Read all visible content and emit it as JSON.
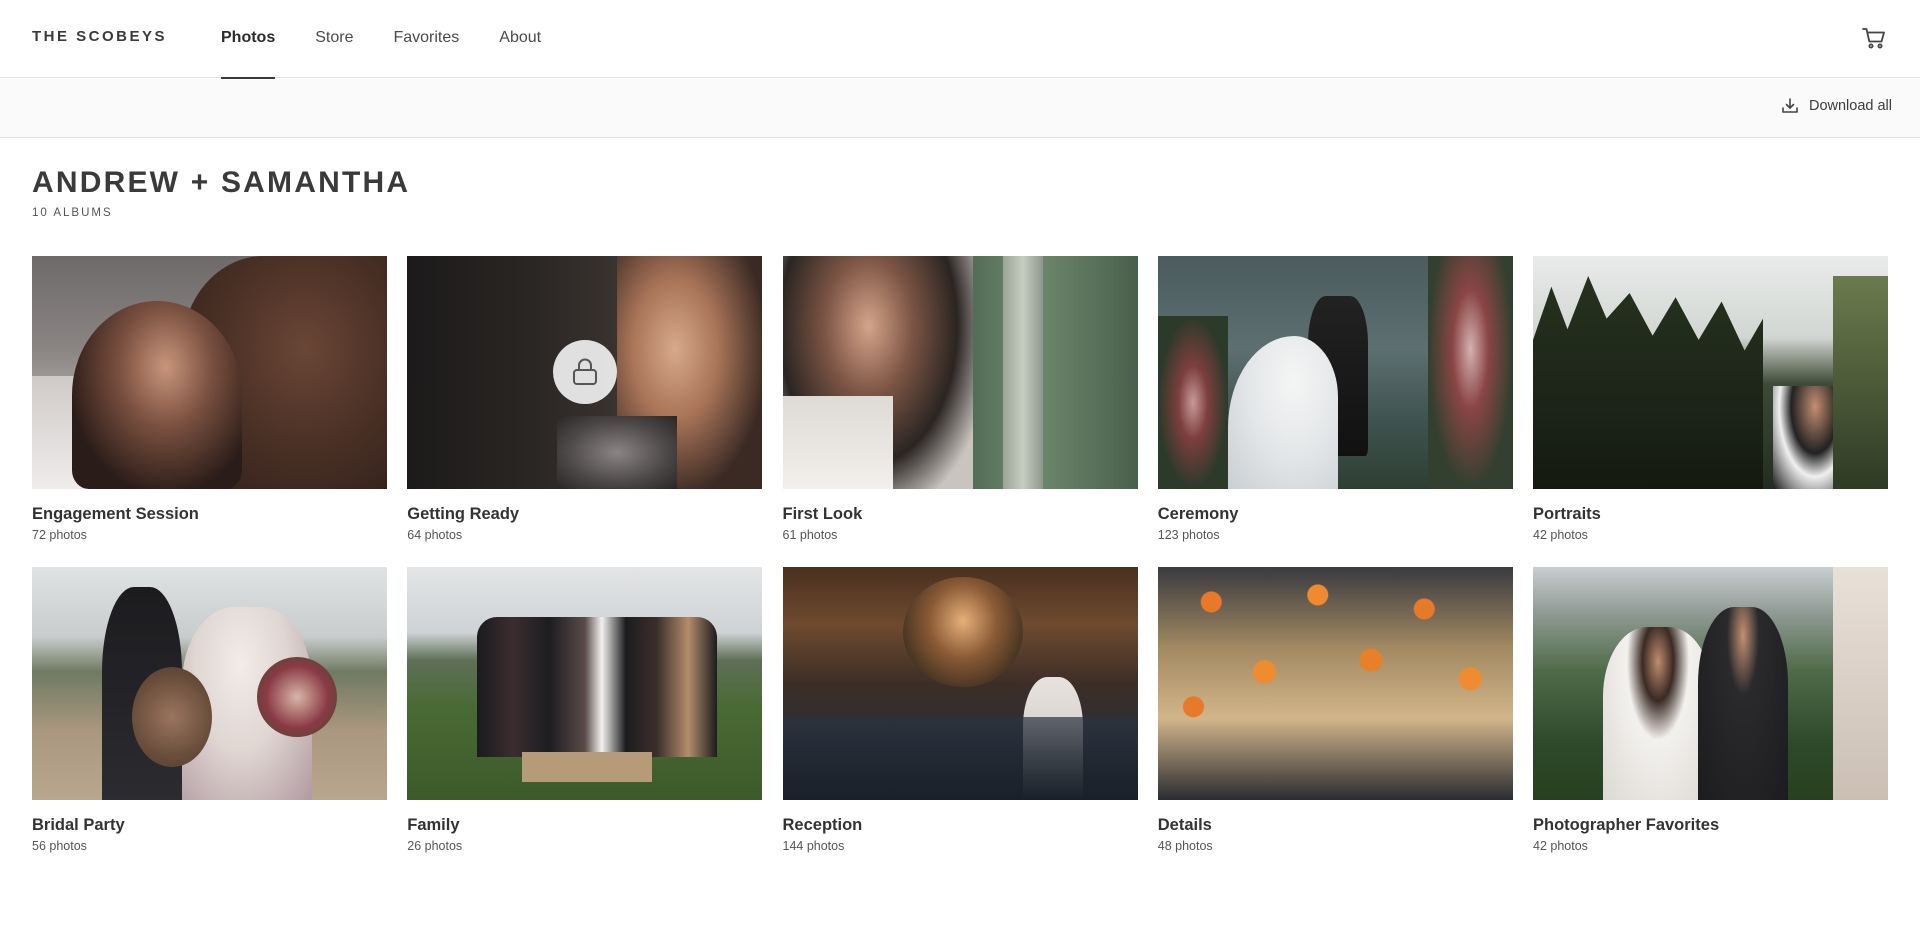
{
  "brand": "THE SCOBEYS",
  "nav": [
    {
      "label": "Photos",
      "active": true
    },
    {
      "label": "Store",
      "active": false
    },
    {
      "label": "Favorites",
      "active": false
    },
    {
      "label": "About",
      "active": false
    }
  ],
  "cart_icon": "cart-icon",
  "toolbar": {
    "download_label": "Download all",
    "download_icon": "download-icon"
  },
  "gallery": {
    "title": "ANDREW + SAMANTHA",
    "subtitle": "10 ALBUMS"
  },
  "albums": [
    {
      "name": "Engagement Session",
      "count": "72 photos",
      "locked": false
    },
    {
      "name": "Getting Ready",
      "count": "64 photos",
      "locked": true
    },
    {
      "name": "First Look",
      "count": "61 photos",
      "locked": false
    },
    {
      "name": "Ceremony",
      "count": "123 photos",
      "locked": false
    },
    {
      "name": "Portraits",
      "count": "42 photos",
      "locked": false
    },
    {
      "name": "Bridal Party",
      "count": "56 photos",
      "locked": false
    },
    {
      "name": "Family",
      "count": "26 photos",
      "locked": false
    },
    {
      "name": "Reception",
      "count": "144 photos",
      "locked": false
    },
    {
      "name": "Details",
      "count": "48 photos",
      "locked": false
    },
    {
      "name": "Photographer Favorites",
      "count": "42 photos",
      "locked": false
    }
  ]
}
